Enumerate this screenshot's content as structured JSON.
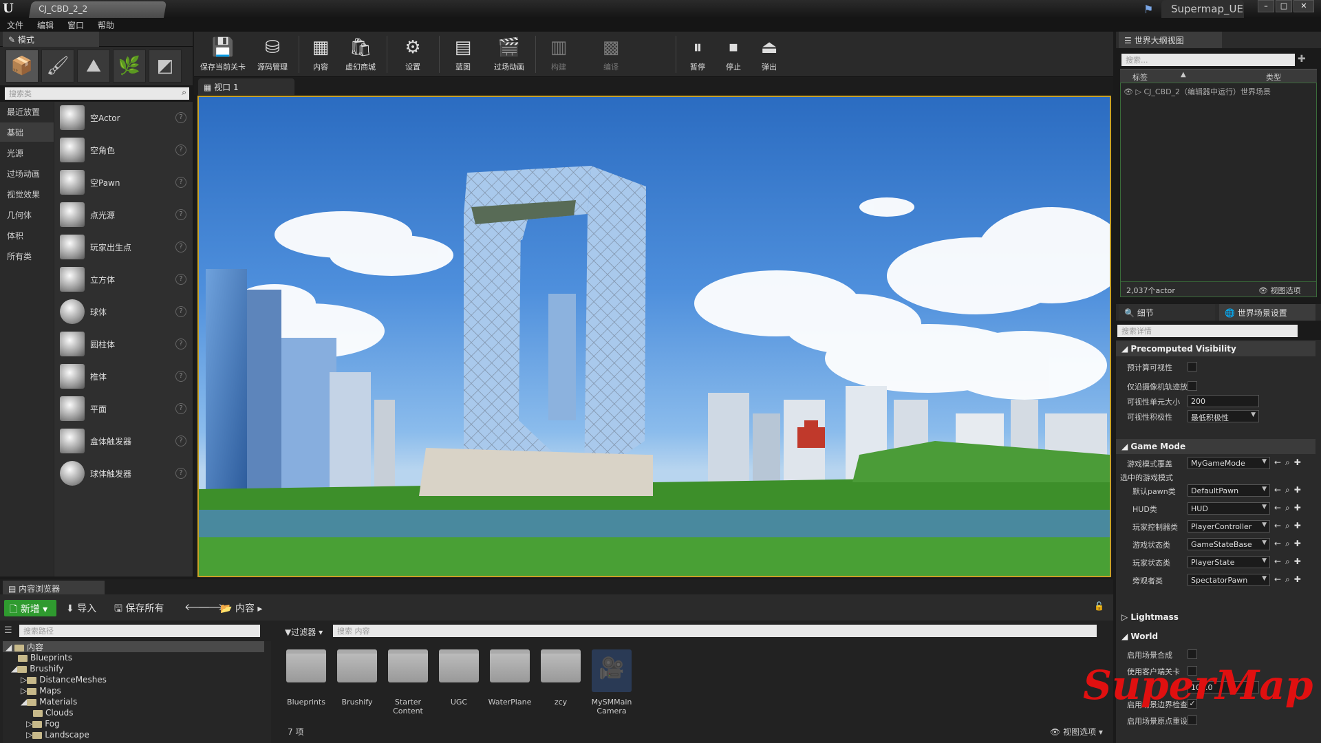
{
  "app": {
    "doc_tab": "CJ_CBD_2_2",
    "project": "Supermap_UE"
  },
  "menu": [
    "文件",
    "编辑",
    "窗口",
    "帮助"
  ],
  "modes": {
    "tab_label": "模式",
    "search_placeholder": "搜索类",
    "categories": [
      "最近放置",
      "基础",
      "光源",
      "过场动画",
      "视觉效果",
      "几何体",
      "体积",
      "所有类"
    ],
    "items": [
      "空Actor",
      "空角色",
      "空Pawn",
      "点光源",
      "玩家出生点",
      "立方体",
      "球体",
      "圆柱体",
      "椎体",
      "平面",
      "盒体触发器",
      "球体触发器"
    ]
  },
  "toolbar": [
    "保存当前关卡",
    "源码管理",
    "内容",
    "虚幻商城",
    "设置",
    "蓝图",
    "过场动画",
    "构建",
    "编译",
    "暂停",
    "停止",
    "弹出"
  ],
  "viewport": {
    "tab_label": "视口 1"
  },
  "outliner": {
    "tab_label": "世界大纲视图",
    "search_placeholder": "搜索...",
    "col_label": "标签",
    "col_type": "类型",
    "row": "CJ_CBD_2（编辑器中运行）世界场景",
    "count": "2,037个actor",
    "view_options": "视图选项"
  },
  "details": {
    "tab1": "细节",
    "tab2": "世界场景设置",
    "search_placeholder": "搜索详情",
    "sections": [
      "Precomputed Visibility",
      "Game Mode",
      "Lightmass",
      "World"
    ],
    "pv": {
      "label1": "预计算可视性",
      "label2": "仅沿摄像机轨迹放",
      "label3": "可视性单元大小",
      "cell_size": "200",
      "label4": "可视性积极性",
      "aggr": "最低积极性"
    },
    "gm": {
      "override_label": "游戏模式覆盖",
      "override_value": "MyGameMode",
      "selected_label": "选中的游戏模式",
      "rows": [
        {
          "label": "默认pawn类",
          "value": "DefaultPawn"
        },
        {
          "label": "HUD类",
          "value": "HUD"
        },
        {
          "label": "玩家控制器类",
          "value": "PlayerController"
        },
        {
          "label": "游戏状态类",
          "value": "GameStateBase"
        },
        {
          "label": "玩家状态类",
          "value": "PlayerState"
        },
        {
          "label": "旁观者类",
          "value": "SpectatorPawn"
        }
      ]
    },
    "world": {
      "r1": "启用场景合成",
      "r2": "使用客户端关卡",
      "r3_value": "100.0",
      "r4": "启用场景边界检查",
      "r5": "启用场景原点重设"
    }
  },
  "content_browser": {
    "tab_label": "内容浏览器",
    "new_label": "新增",
    "import_label": "导入",
    "save_all_label": "保存所有",
    "path_label": "内容",
    "path_search_placeholder": "搜索路径",
    "filter_label": "过滤器",
    "content_search_placeholder": "搜索 内容",
    "tree": [
      "内容",
      "Blueprints",
      "Brushify",
      "DistanceMeshes",
      "Maps",
      "Materials",
      "Clouds",
      "Fog",
      "Landscape"
    ],
    "assets": [
      "Blueprints",
      "Brushify",
      "Starter Content",
      "UGC",
      "WaterPlane",
      "zcy",
      "MySMMain Camera"
    ],
    "count": "7 项",
    "view_options": "视图选项"
  },
  "watermark": "SuperMap",
  "colors": {
    "accent_green": "#2f9a2f",
    "viewport_border": "#c9a227",
    "watermark_red": "#e01010"
  }
}
